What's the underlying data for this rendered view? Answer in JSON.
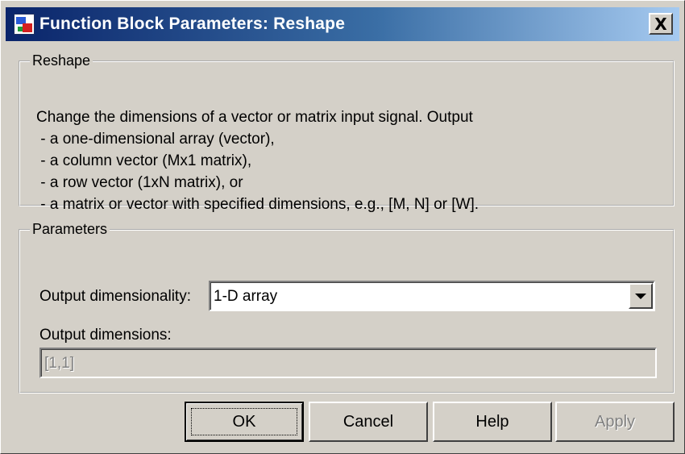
{
  "window": {
    "title": "Function Block Parameters: Reshape",
    "close_label": "X"
  },
  "reshape_group": {
    "legend": "Reshape",
    "description_lines": [
      "Change the dimensions of a vector or matrix input signal. Output",
      " - a one-dimensional array (vector),",
      " - a column vector (Mx1 matrix),",
      " - a row vector (1xN matrix), or",
      " - a matrix or vector with specified dimensions, e.g., [M, N] or [W]."
    ]
  },
  "parameters_group": {
    "legend": "Parameters",
    "output_dimensionality_label": "Output dimensionality:",
    "output_dimensionality_value": "1-D array",
    "output_dimensions_label": "Output dimensions:",
    "output_dimensions_value": "[1,1]"
  },
  "buttons": {
    "ok": "OK",
    "cancel": "Cancel",
    "help": "Help",
    "apply": "Apply"
  },
  "icons": {
    "app": "simulink-block-icon",
    "dropdown": "chevron-down-icon"
  },
  "colors": {
    "titlebar_start": "#0a246a",
    "titlebar_end": "#a6caf0",
    "face": "#d4d0c8"
  }
}
